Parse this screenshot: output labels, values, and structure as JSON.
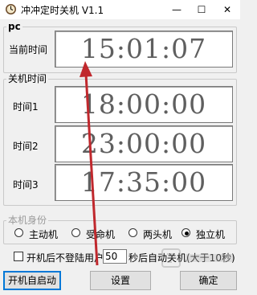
{
  "window": {
    "title": "冲冲定时关机 V1.1",
    "controls": {
      "minimize": "—",
      "maximize": "☐",
      "close": "✕"
    }
  },
  "pc_group": {
    "legend": "pc",
    "current_time_label": "当前时间",
    "current_time": "15:01:07"
  },
  "shutdown_group": {
    "legend": "关机时间",
    "times": [
      {
        "label": "时间1",
        "value": "18:00:00"
      },
      {
        "label": "时间2",
        "value": "23:00:00"
      },
      {
        "label": "时间3",
        "value": "17:35:00"
      }
    ]
  },
  "role_group": {
    "legend": "本机身份",
    "options": [
      {
        "label": "主动机",
        "selected": false
      },
      {
        "label": "受命机",
        "selected": false
      },
      {
        "label": "两头机",
        "selected": false
      },
      {
        "label": "独立机",
        "selected": true
      }
    ]
  },
  "auto_shutdown": {
    "checked": false,
    "label_before": "开机后不登陆用户",
    "seconds": "50",
    "label_after": "秒后自动关机(大于10秒)"
  },
  "buttons": {
    "autostart": "开机自启动",
    "settings": "设置",
    "ok": "确定"
  },
  "colors": {
    "annotation_arrow": "#c0282d",
    "clock_text": "#5f5f5f"
  }
}
